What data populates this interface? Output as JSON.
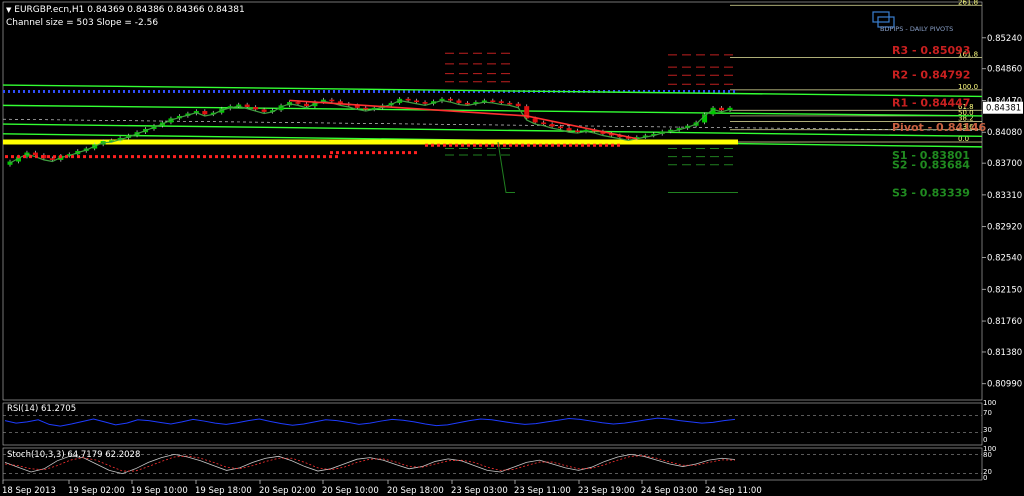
{
  "header": {
    "symbol_line": "EURGBP.ecn,H1  0.84369 0.84386 0.84366 0.84381",
    "channel_line": "Channel size = 503 Slope = -2.56"
  },
  "watermark": "BDPIPS - DAILY PIVOTS",
  "colors": {
    "background": "#000000",
    "grid_dots": "#a0a0a0",
    "bull_candle": "#00c800",
    "bear_candle": "#e01010",
    "channel": "#33ff33",
    "yellow_level": "#ffff00",
    "ma": "#40a040",
    "rsi_line": "#1e3cff",
    "stoch_main": "#c8c8c8",
    "stoch_signal": "#ff3030",
    "pivot_res": "#c02020",
    "pivot_sup": "#208020"
  },
  "chart_data": {
    "type": "candlestick",
    "symbol": "EURGBP.ecn",
    "timeframe": "H1",
    "ohlc_last": {
      "open": 0.84369,
      "high": 0.84386,
      "low": 0.84366,
      "close": 0.84381
    },
    "current_price": "0.84381",
    "y_axis": {
      "range": [
        0.8079,
        0.8568
      ],
      "ticks": [
        0.8524,
        0.8486,
        0.8447,
        0.8408,
        0.837,
        0.8331,
        0.8292,
        0.8254,
        0.8215,
        0.8176,
        0.8138,
        0.8099
      ],
      "tick_labels": [
        "0.85240",
        "0.84860",
        "0.84470",
        "0.84080",
        "0.83700",
        "0.83310",
        "0.82920",
        "0.82540",
        "0.82150",
        "0.81760",
        "0.81380",
        "0.80990"
      ]
    },
    "x_axis": {
      "tick_labels": [
        "18 Sep 2013",
        "19 Sep 02:00",
        "19 Sep 10:00",
        "19 Sep 18:00",
        "20 Sep 02:00",
        "20 Sep 10:00",
        "20 Sep 18:00",
        "23 Sep 03:00",
        "23 Sep 11:00",
        "23 Sep 19:00",
        "24 Sep 03:00",
        "24 Sep 11:00"
      ]
    },
    "closes": [
      0.8372,
      0.8378,
      0.8383,
      0.838,
      0.8376,
      0.8374,
      0.8379,
      0.8381,
      0.8385,
      0.8388,
      0.8393,
      0.8397,
      0.8398,
      0.8401,
      0.8404,
      0.8408,
      0.8412,
      0.8416,
      0.842,
      0.8425,
      0.8428,
      0.8431,
      0.8434,
      0.843,
      0.8432,
      0.8437,
      0.844,
      0.8442,
      0.8439,
      0.8436,
      0.8433,
      0.8435,
      0.8441,
      0.8445,
      0.8443,
      0.844,
      0.8445,
      0.8448,
      0.8446,
      0.8443,
      0.8441,
      0.8438,
      0.8436,
      0.8438,
      0.8441,
      0.8444,
      0.8449,
      0.8447,
      0.8445,
      0.8443,
      0.8446,
      0.8449,
      0.8447,
      0.8444,
      0.8443,
      0.8445,
      0.8447,
      0.8446,
      0.8444,
      0.8443,
      0.844,
      0.8425,
      0.842,
      0.8418,
      0.8415,
      0.8413,
      0.841,
      0.8409,
      0.8411,
      0.8409,
      0.8406,
      0.8404,
      0.8402,
      0.84,
      0.8402,
      0.8404,
      0.8406,
      0.8409,
      0.8411,
      0.8413,
      0.8416,
      0.842,
      0.843,
      0.8438,
      0.8435,
      0.8438
    ],
    "fib_levels": [
      {
        "label": "261.8",
        "value": 0.8564
      },
      {
        "label": "161.8",
        "value": 0.85
      },
      {
        "label": "100.0",
        "value": 0.846
      },
      {
        "label": "61.8",
        "value": 0.8435
      },
      {
        "label": "50.0",
        "value": 0.8428
      },
      {
        "label": "38.2",
        "value": 0.8421
      },
      {
        "label": "23.6",
        "value": 0.8411
      },
      {
        "label": "0.0",
        "value": 0.8396
      }
    ],
    "pivots": [
      {
        "label": "R3 - 0.85093",
        "value": 0.85093,
        "kind": "res"
      },
      {
        "label": "R2 - 0.84792",
        "value": 0.84792,
        "kind": "res"
      },
      {
        "label": "R1 - 0.84447",
        "value": 0.84447,
        "kind": "res"
      },
      {
        "label": "Pivot - 0.84146",
        "value": 0.84146,
        "kind": "pivot"
      },
      {
        "label": "S1 - 0.83801",
        "value": 0.83801,
        "kind": "sup"
      },
      {
        "label": "S2 - 0.83684",
        "value": 0.83684,
        "kind": "sup"
      },
      {
        "label": "S3 - 0.83339",
        "value": 0.83339,
        "kind": "sup"
      }
    ],
    "rsi": {
      "label": "RSI(14) 61.2705",
      "levels": [
        "100",
        "70",
        "30",
        "0"
      ],
      "values": [
        58,
        52,
        55,
        60,
        49,
        45,
        50,
        56,
        62,
        55,
        48,
        52,
        60,
        58,
        54,
        50,
        55,
        61,
        57,
        52,
        49,
        53,
        58,
        62,
        56,
        51,
        47,
        50,
        55,
        60,
        58,
        54,
        49,
        52,
        57,
        61,
        59,
        55,
        50,
        46,
        48,
        53,
        58,
        62,
        60,
        56,
        52,
        49,
        51,
        55,
        59,
        63,
        61,
        57,
        53,
        50,
        52,
        56,
        60,
        64,
        62,
        58,
        55,
        52,
        54,
        58,
        61
      ]
    },
    "stoch": {
      "label": "Stoch(10,3,3) 64.7179 62.2028",
      "levels": [
        "100",
        "80",
        "20",
        "0"
      ],
      "main": [
        55,
        40,
        25,
        35,
        60,
        75,
        70,
        50,
        30,
        20,
        35,
        55,
        70,
        80,
        72,
        60,
        45,
        30,
        38,
        55,
        68,
        74,
        60,
        42,
        28,
        35,
        50,
        65,
        70,
        62,
        48,
        35,
        42,
        58,
        66,
        60,
        45,
        30,
        25,
        40,
        55,
        62,
        50,
        38,
        30,
        40,
        58,
        72,
        80,
        74,
        62,
        50,
        42,
        50,
        62,
        68,
        64
      ],
      "signal": [
        50,
        45,
        35,
        32,
        45,
        62,
        70,
        62,
        45,
        28,
        28,
        42,
        58,
        72,
        75,
        68,
        55,
        40,
        35,
        45,
        58,
        68,
        68,
        55,
        38,
        32,
        40,
        55,
        65,
        66,
        56,
        42,
        40,
        50,
        60,
        62,
        55,
        40,
        30,
        33,
        45,
        56,
        56,
        45,
        35,
        36,
        48,
        62,
        74,
        76,
        68,
        56,
        46,
        46,
        55,
        63,
        62
      ]
    }
  }
}
